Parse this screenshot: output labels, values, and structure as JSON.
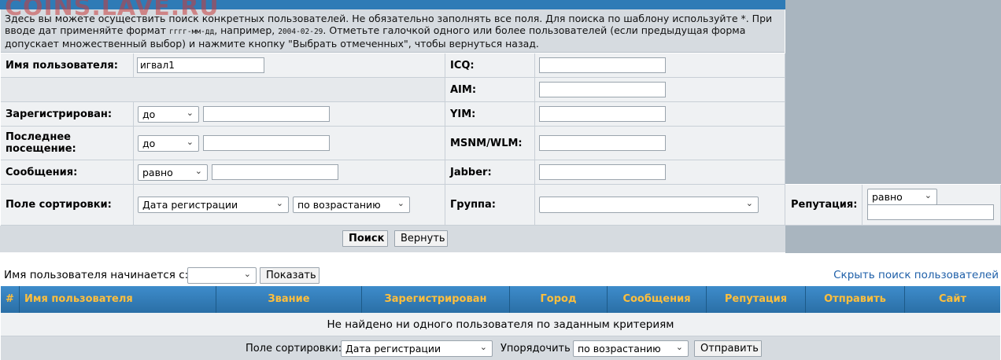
{
  "watermark": "COINS.LAVE.RU",
  "intro": {
    "part1": "Здесь вы можете осуществить поиск конкретных пользователей. Не обязательно заполнять все поля. Для поиска по шаблону используйте *. При вводе дат применяйте формат ",
    "date_format": "гггг-мм-дд",
    "part2": ", например, ",
    "date_example": "2004-02-29",
    "part3": ". Отметьте галочкой одного или более пользователей (если предыдущая форма допускает множественный выбор) и нажмите кнопку \"Выбрать отмеченных\", чтобы вернуться назад."
  },
  "form": {
    "username_label": "Имя пользователя:",
    "username_value": "игвал1",
    "registered_label": "Зарегистрирован:",
    "registered_op": "до",
    "last_visit_label": "Последнее посещение:",
    "last_visit_op": "до",
    "posts_label": "Сообщения:",
    "posts_op": "равно",
    "sort_label": "Поле сортировки:",
    "sort_field": "Дата регистрации",
    "sort_order": "по возрастанию",
    "icq_label": "ICQ:",
    "aim_label": "AIM:",
    "yim_label": "YIM:",
    "msnm_label": "MSNM/WLM:",
    "jabber_label": "Jabber:",
    "group_label": "Группа:",
    "group_value": "",
    "reputation_label": "Репутация:",
    "reputation_op": "равно",
    "search_button": "Поиск",
    "reset_button": "Вернуть"
  },
  "filter": {
    "starts_with_label": "Имя пользователя начинается с:",
    "starts_with_value": "",
    "show_button": "Показать",
    "hide_link": "Скрыть поиск пользователей"
  },
  "table": {
    "headers": [
      "#",
      "Имя пользователя",
      "Звание",
      "Зарегистрирован",
      "Город",
      "Сообщения",
      "Репутация",
      "Отправить",
      "Сайт"
    ],
    "empty_message": "Не найдено ни одного пользователя по заданным критериям"
  },
  "bottom": {
    "sort_label": "Поле сортировки:",
    "sort_field": "Дата регистрации",
    "order_label": "Упорядочить",
    "order_value": "по возрастанию",
    "submit_button": "Отправить"
  },
  "colors": {
    "header_bar": "#2f7bb6",
    "header_text": "#ffbf3c",
    "panel": "#eff1f3",
    "link": "#1e5fa8"
  }
}
